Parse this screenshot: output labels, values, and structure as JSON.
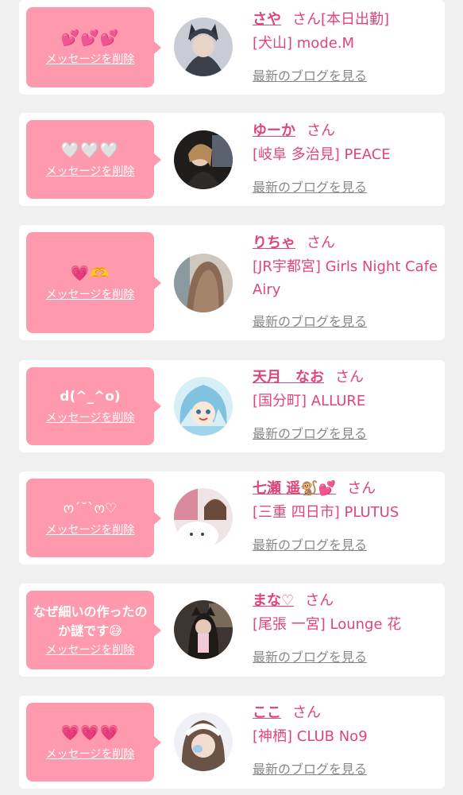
{
  "messages": [
    {
      "message": "💕💕💕",
      "emoji": true,
      "delete_label": "メッセージを削除",
      "name": "さや",
      "honorific": "さん[本日出勤]",
      "shop": "[犬山] mode.M",
      "blog_label": "最新のブログを見る",
      "avatar_color": "#3a3f4a"
    },
    {
      "message": "🤍🤍🤍",
      "emoji": true,
      "white": true,
      "delete_label": "メッセージを削除",
      "name": "ゆーか",
      "honorific": "さん",
      "shop": "[岐阜 多治見] PEACE",
      "blog_label": "最新のブログを見る",
      "avatar_color": "#2e2a28"
    },
    {
      "message": "💗🫶",
      "emoji": true,
      "delete_label": "メッセージを削除",
      "name": "りちゃ",
      "honorific": "さん",
      "shop": "[JR宇都宮] Girls Night Cafe Airy",
      "blog_label": "最新のブログを見る",
      "avatar_color": "#8a6a55"
    },
    {
      "message": "d(^_^o)",
      "emoji": false,
      "delete_label": "メッセージを削除",
      "name": "天月　なお",
      "honorific": "さん",
      "shop": "[国分町] ALLURE",
      "blog_label": "最新のブログを見る",
      "avatar_color": "#7fc3e0"
    },
    {
      "message": "ო´˘`ო♡",
      "emoji": false,
      "delete_label": "メッセージを削除",
      "name": "七瀬 遥🐒💕",
      "honorific": "さん",
      "shop": "[三重 四日市] PLUTUS",
      "blog_label": "最新のブログを見る",
      "avatar_color": "#d9c8c0"
    },
    {
      "message": "なぜ細いの作ったのか謎です😅",
      "emoji": false,
      "delete_label": "メッセージを削除",
      "name": "まな♡",
      "honorific": "さん",
      "shop": "[尾張 一宮] Lounge 花",
      "blog_label": "最新のブログを見る",
      "avatar_color": "#4a3a30"
    },
    {
      "message": "💗💗💗",
      "emoji": true,
      "delete_label": "メッセージを削除",
      "name": "ここ",
      "honorific": "さん",
      "shop": "[神栖] CLUB No9",
      "blog_label": "最新のブログを見る",
      "avatar_color": "#b7c9e6"
    }
  ]
}
